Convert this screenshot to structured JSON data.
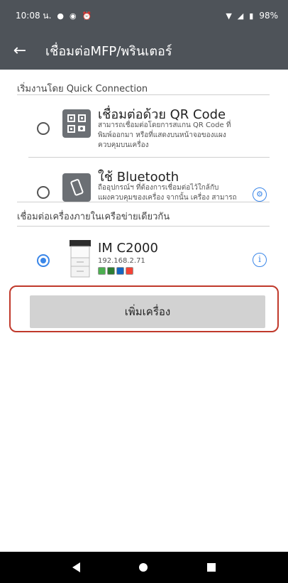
{
  "status_bar": {
    "time": "10:08 น.",
    "battery": "98%",
    "icons": [
      "chat-icon",
      "notification-icon",
      "alarm-icon",
      "wifi-icon",
      "signal-icon",
      "battery-icon"
    ]
  },
  "app_bar": {
    "title": "เชื่อมต่อMFP/พรินเตอร์",
    "back_icon": "arrow-left-icon"
  },
  "quick_connection": {
    "section_label": "เริ่มงานโดย Quick Connection",
    "options": [
      {
        "title": "เชื่อมต่อด้วย QR Code",
        "desc_line1": "สามารถเชื่อมต่อโดยการสแกน QR Code ที่",
        "desc_line2": "พิมพ์ออกมา หรือที่แสดงบนหน้าจอของแผง",
        "desc_line3": "ควบคุมบนเครื่อง",
        "icon": "qr-code-icon",
        "selected": false
      },
      {
        "title": "ใช้ Bluetooth",
        "desc_line1": "ถืออุปกรณ์ฯ ที่ต้องการเชื่อมต่อไว้ใกล้กับ",
        "desc_line2": "แผงควบคุมของเครื่อง จากนั้น เครื่อง สามารถ",
        "icon": "bluetooth-phone-icon",
        "selected": false
      }
    ]
  },
  "network_section": {
    "section_label": "เชื่อมต่อเครื่องภายในเครือข่ายเดียวกัน",
    "printers": [
      {
        "name": "IM C2000",
        "ip": "192.168.2.71",
        "selected": true,
        "badge_colors": [
          "#4caf50",
          "#2e7d32",
          "#1565c0",
          "#f44336"
        ]
      }
    ]
  },
  "add_button": {
    "label": "เพิ่มเครื่อง"
  },
  "colors": {
    "header": "#4e5359",
    "accent": "#3a86e8",
    "highlight": "#c0392b",
    "button_bg": "#d2d2d2"
  }
}
